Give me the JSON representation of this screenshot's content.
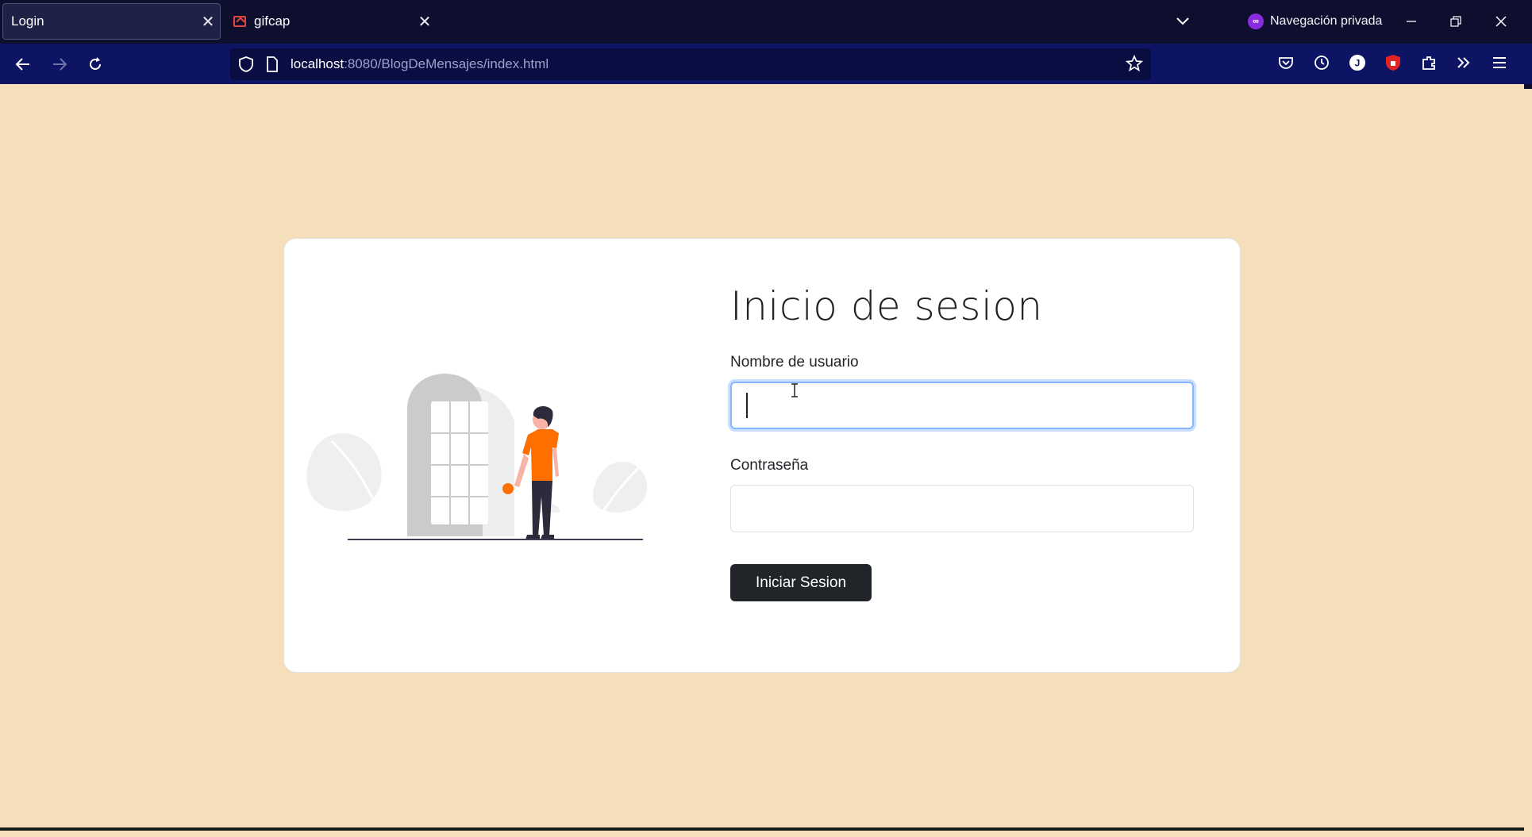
{
  "browser": {
    "tabs": [
      {
        "title": "Login",
        "active": true
      },
      {
        "title": "gifcap",
        "active": false
      }
    ],
    "private_label": "Navegación privada",
    "url": {
      "host": "localhost",
      "path": ":8080/BlogDeMensajes/index.html"
    },
    "colors": {
      "tabbar": "#0e0f2f",
      "navbar": "#0d1463",
      "private_badge": "#8a2be2"
    }
  },
  "page": {
    "background": "#f5dfbb",
    "title": "Inicio de sesion",
    "username_label": "Nombre de usuario",
    "username_value": "",
    "password_label": "Contraseña",
    "password_value": "",
    "submit_label": "Iniciar Sesion",
    "colors": {
      "button": "#212529",
      "focus_ring": "#86b7fe",
      "person_shirt": "#ff6f00"
    }
  }
}
